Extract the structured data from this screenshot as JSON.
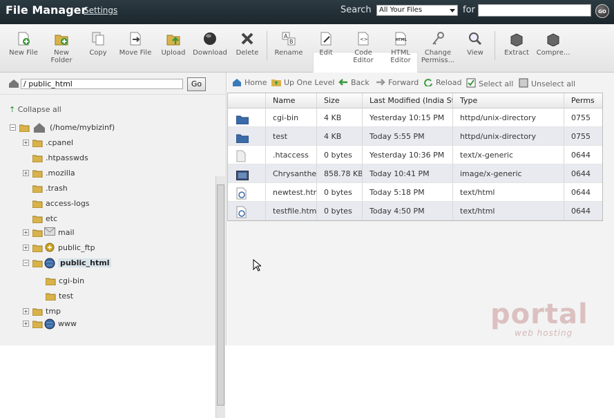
{
  "header": {
    "title": "File Manager",
    "settings_link": "Settings",
    "search_label": "Search",
    "search_scope": "All Your Files",
    "for_label": "for",
    "search_value": "",
    "go_label": "GO"
  },
  "toolbar": {
    "new_file": "New File",
    "new_folder_1": "New",
    "new_folder_2": "Folder",
    "copy": "Copy",
    "move_file": "Move File",
    "upload": "Upload",
    "download": "Download",
    "delete": "Delete",
    "rename": "Rename",
    "edit": "Edit",
    "code_editor_1": "Code",
    "code_editor_2": "Editor",
    "html_editor_1": "HTML",
    "html_editor_2": "Editor",
    "change_perms_1": "Change",
    "change_perms_2": "Permiss...",
    "view": "View",
    "extract": "Extract",
    "compress": "Compre..."
  },
  "left": {
    "path": "/ public_html",
    "go": "Go",
    "collapse_all": "Collapse all",
    "root": "(/home/mybizinf)",
    "tree": [
      ".cpanel",
      ".htpasswds",
      ".mozilla",
      ".trash",
      "access-logs",
      "etc",
      "mail",
      "public_ftp",
      "public_html",
      "cgi-bin",
      "test",
      "tmp",
      "www"
    ]
  },
  "nav": {
    "home": "Home",
    "up_one_level": "Up One Level",
    "back": "Back",
    "forward": "Forward",
    "reload": "Reload",
    "select_all": "Select all",
    "unselect_all": "Unselect all"
  },
  "table": {
    "columns": [
      "",
      "Name",
      "Size",
      "Last Modified (India Standard Time)",
      "Type",
      "Perms"
    ],
    "rows": [
      {
        "name": "cgi-bin",
        "size": "4 KB",
        "modified": "Yesterday 10:15 PM",
        "type": "httpd/unix-directory",
        "perms": "0755",
        "icon": "folder-icon"
      },
      {
        "name": "test",
        "size": "4 KB",
        "modified": "Today 5:55 PM",
        "type": "httpd/unix-directory",
        "perms": "0755",
        "icon": "folder-icon"
      },
      {
        "name": ".htaccess",
        "size": "0 bytes",
        "modified": "Yesterday 10:36 PM",
        "type": "text/x-generic",
        "perms": "0644",
        "icon": "text-file-icon"
      },
      {
        "name": "Chrysanthemum.jpg",
        "size": "858.78 KB",
        "modified": "Today 10:41 PM",
        "type": "image/x-generic",
        "perms": "0644",
        "icon": "image-file-icon"
      },
      {
        "name": "newtest.html",
        "size": "0 bytes",
        "modified": "Today 5:18 PM",
        "type": "text/html",
        "perms": "0644",
        "icon": "html-file-icon"
      },
      {
        "name": "testfile.html",
        "size": "0 bytes",
        "modified": "Today 4:50 PM",
        "type": "text/html",
        "perms": "0644",
        "icon": "html-file-icon"
      }
    ]
  },
  "watermark": {
    "main": "portal",
    "sub": "web hosting"
  },
  "colors": {
    "header_bg": "#1f2b31",
    "folder": "#3a6aa8",
    "accent_green": "#3a9a3a"
  }
}
